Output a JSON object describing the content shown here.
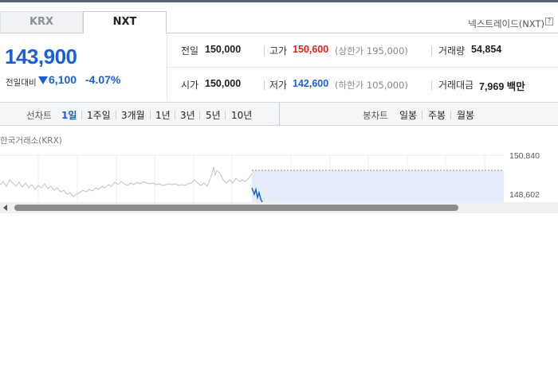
{
  "tabs": [
    {
      "label": "KRX",
      "active": false
    },
    {
      "label": "NXT",
      "active": true
    }
  ],
  "nxt_info": {
    "label": "넥스트레이드(NXT)",
    "help_icon": "?"
  },
  "quote": {
    "price": "143,900",
    "change_label": "전일대비",
    "change_direction": "down",
    "change_abs": "6,100",
    "change_pct": "-4.07%"
  },
  "stats": {
    "prev_close": {
      "label": "전일",
      "value": "150,000"
    },
    "open": {
      "label": "시가",
      "value": "150,000"
    },
    "high": {
      "label": "고가",
      "value": "150,600",
      "sub": "(상한가 195,000)"
    },
    "low": {
      "label": "저가",
      "value": "142,600",
      "sub": "(하한가 105,000)"
    },
    "volume": {
      "label": "거래량",
      "value": "54,854"
    },
    "amount": {
      "label": "거래대금",
      "value": "7,969 백만"
    }
  },
  "toolbar": {
    "line_label": "선차트",
    "periods": [
      "1일",
      "1주일",
      "3개월",
      "1년",
      "3년",
      "5년",
      "10년"
    ],
    "active_period": "1일",
    "candle_label": "봉차트",
    "candles": [
      "일봉",
      "주봉",
      "월봉"
    ]
  },
  "chart": {
    "exchange_label": "한국거래소(KRX)",
    "y_top": "150,840",
    "y_bottom": "148,602"
  },
  "colors": {
    "up": "#e0201c",
    "down": "#1a5fd6",
    "accent": "#1a5fd6"
  }
}
